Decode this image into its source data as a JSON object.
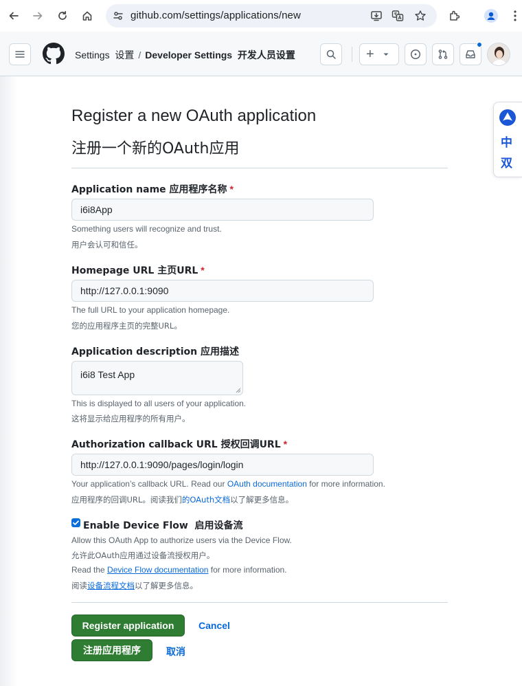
{
  "browser": {
    "url": "github.com/settings/applications/new"
  },
  "header": {
    "crumb_settings": "Settings",
    "crumb_settings_cn": "设置",
    "crumb_separator": "/",
    "crumb_developer": "Developer Settings",
    "crumb_developer_cn": "开发人员设置",
    "new_menu_plus": "+"
  },
  "translate_widget": {
    "mode_label": "中",
    "dual_label": "双"
  },
  "page": {
    "title": "Register a new OAuth application",
    "title_cn": "注册一个新的OAuth应用"
  },
  "form": {
    "app_name": {
      "label": "Application name 应用程序名称",
      "required_mark": "*",
      "value": "i6i8App",
      "hint": "Something users will recognize and trust.",
      "hint_cn": "用户会认可和信任。"
    },
    "homepage": {
      "label": "Homepage URL 主页URL",
      "required_mark": "*",
      "value": "http://127.0.0.1:9090",
      "hint": "The full URL to your application homepage.",
      "hint_cn": "您的应用程序主页的完整URL。"
    },
    "description": {
      "label": "Application description 应用描述",
      "value": "i6i8 Test App",
      "hint": "This is displayed to all users of your application.",
      "hint_cn": "这将显示给应用程序的所有用户。"
    },
    "callback": {
      "label": "Authorization callback URL 授权回调URL",
      "required_mark": "*",
      "value": "http://127.0.0.1:9090/pages/login/login",
      "hint_pre": "Your application’s callback URL. Read our",
      "hint_link": "OAuth documentation",
      "hint_post": "for more information.",
      "hint_cn_pre": "应用程序的回调URL。阅读我们",
      "hint_cn_link": "的OAuth文档",
      "hint_cn_post": "以了解更多信息。"
    },
    "device_flow": {
      "checked": true,
      "label": "Enable Device Flow  启用设备流",
      "hint": "Allow this OAuth App to authorize users via the Device Flow.",
      "hint_cn": "允许此OAuth应用通过设备流授权用户。",
      "read_pre": "Read the",
      "read_link": "Device Flow documentation",
      "read_post": "for more information.",
      "read_cn_pre": "阅读",
      "read_cn_link": "设备流程文档",
      "read_cn_post": "以了解更多信息。"
    },
    "buttons": {
      "register": "Register application",
      "cancel": "Cancel",
      "register_cn": "注册应用程序",
      "cancel_cn": "取消"
    }
  },
  "colors": {
    "primary_button": "#2f7d32",
    "link": "#0969da",
    "required": "#cf222e",
    "border": "#d1d9e0",
    "header_bg": "#f6f8fa"
  }
}
